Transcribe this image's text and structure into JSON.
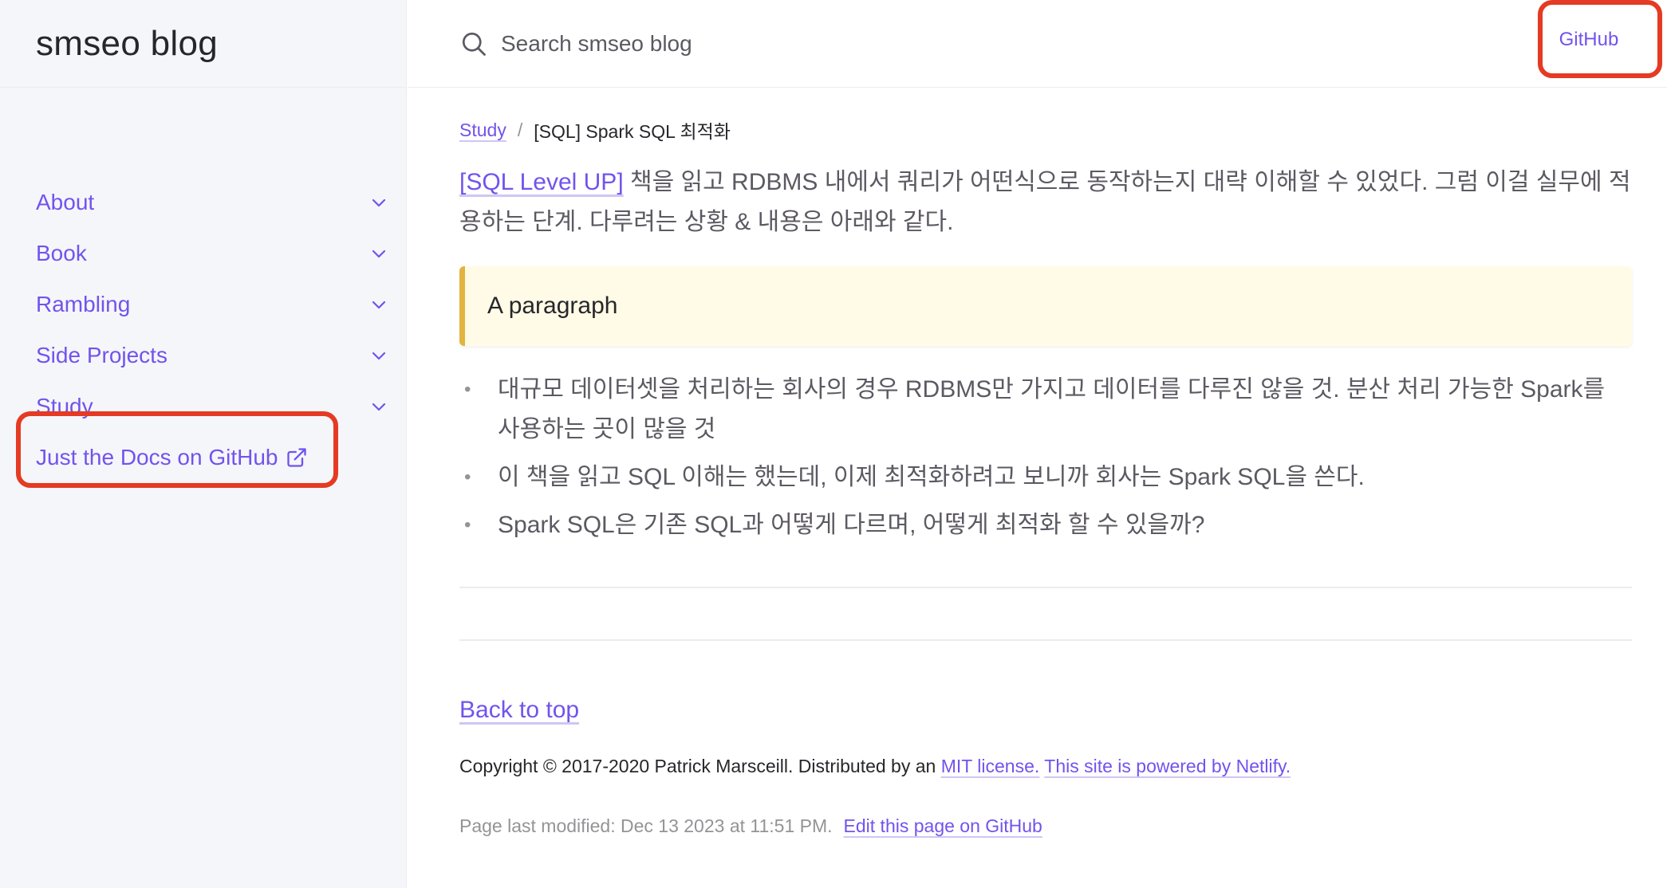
{
  "site": {
    "title": "smseo blog"
  },
  "sidebar": {
    "items": [
      {
        "label": "About"
      },
      {
        "label": "Book"
      },
      {
        "label": "Rambling"
      },
      {
        "label": "Side Projects"
      },
      {
        "label": "Study"
      }
    ],
    "external_link": {
      "label": "Just the Docs on GitHub"
    }
  },
  "search": {
    "placeholder": "Search smseo blog"
  },
  "header": {
    "github_label": "GitHub"
  },
  "breadcrumb": {
    "parent": "Study",
    "separator": "/",
    "current": "[SQL] Spark SQL 최적화"
  },
  "content": {
    "lead_link": "[SQL Level UP]",
    "lead_text": " 책을 읽고 RDBMS 내에서 쿼리가 어떤식으로 동작하는지 대략 이해할 수 있었다. 그럼 이걸 실무에 적용하는 단계. 다루려는 상황 & 내용은 아래와 같다.",
    "note": "A paragraph",
    "bullet_marker": "•",
    "bullets": [
      "대규모 데이터셋을 처리하는 회사의 경우 RDBMS만 가지고 데이터를 다루진 않을 것. 분산 처리 가능한 Spark를 사용하는 곳이 많을 것",
      "이 책을 읽고 SQL 이해는 했는데, 이제 최적화하려고 보니까 회사는 Spark SQL을 쓴다.",
      "Spark SQL은 기존 SQL과 어떻게 다르며, 어떻게 최적화 할 수 있을까?"
    ]
  },
  "footer": {
    "back_to_top": "Back to top",
    "copyright_prefix": "Copyright © 2017-2020 Patrick Marsceill. Distributed by an ",
    "mit_link": "MIT license.",
    "netlify_link": "This site is powered by Netlify.",
    "modified_text": "Page last modified: Dec 13 2023 at 11:51 PM.",
    "edit_link": "Edit this page on GitHub"
  },
  "colors": {
    "accent": "#7253ed",
    "highlight": "#e53a23",
    "note_border": "#e3b341"
  }
}
